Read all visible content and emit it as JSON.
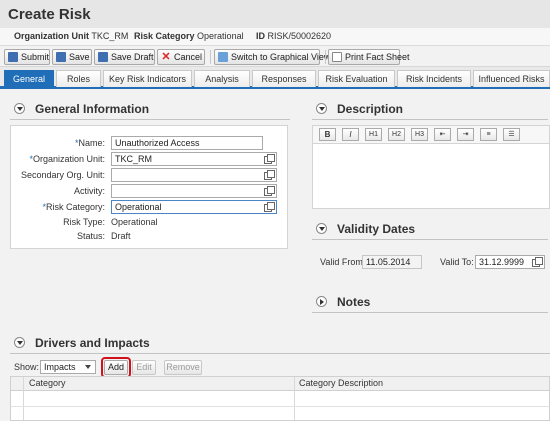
{
  "page": {
    "title": "Create Risk"
  },
  "info": {
    "org_unit_label": "Organization Unit",
    "org_unit_value": "TKC_RM",
    "risk_category_label": "Risk Category",
    "risk_category_value": "Operational",
    "id_label": "ID",
    "id_value": "RISK/50002620"
  },
  "toolbar": {
    "submit": "Submit",
    "save": "Save",
    "save_draft": "Save Draft",
    "cancel": "Cancel",
    "graphical_view": "Switch to Graphical View",
    "print_fact_sheet": "Print Fact Sheet"
  },
  "tabs": [
    {
      "label": "General",
      "active": true
    },
    {
      "label": "Roles"
    },
    {
      "label": "Key Risk Indicators"
    },
    {
      "label": "Analysis"
    },
    {
      "label": "Responses"
    },
    {
      "label": "Risk Evaluation"
    },
    {
      "label": "Risk Incidents"
    },
    {
      "label": "Influenced Risks"
    }
  ],
  "general": {
    "heading": "General Information",
    "name_label": "Name:",
    "name_value": "Unauthorized Access",
    "org_unit_label": "Organization Unit:",
    "org_unit_value": "TKC_RM",
    "secondary_org_label": "Secondary Org. Unit:",
    "secondary_org_value": "",
    "activity_label": "Activity:",
    "activity_value": "",
    "risk_category_label": "Risk Category:",
    "risk_category_value": "Operational",
    "risk_type_label": "Risk Type:",
    "risk_type_value": "Operational",
    "status_label": "Status:",
    "status_value": "Draft"
  },
  "description": {
    "heading": "Description",
    "toolbar": [
      "B",
      "I",
      "H1",
      "H2",
      "H3",
      "indent-left",
      "indent-right",
      "numbered-list",
      "bullet-list"
    ]
  },
  "validity": {
    "heading": "Validity Dates",
    "valid_from_label": "Valid From:",
    "valid_from_value": "11.05.2014",
    "valid_to_label": "Valid To:",
    "valid_to_value": "31.12.9999"
  },
  "notes": {
    "heading": "Notes"
  },
  "drivers": {
    "heading": "Drivers and Impacts",
    "show_label": "Show:",
    "show_value": "Impacts",
    "add": "Add",
    "edit": "Edit",
    "remove": "Remove",
    "columns": [
      "Category",
      "Category Description"
    ]
  },
  "colors": {
    "accent": "#1f6eb7",
    "highlight": "#d0121a"
  }
}
